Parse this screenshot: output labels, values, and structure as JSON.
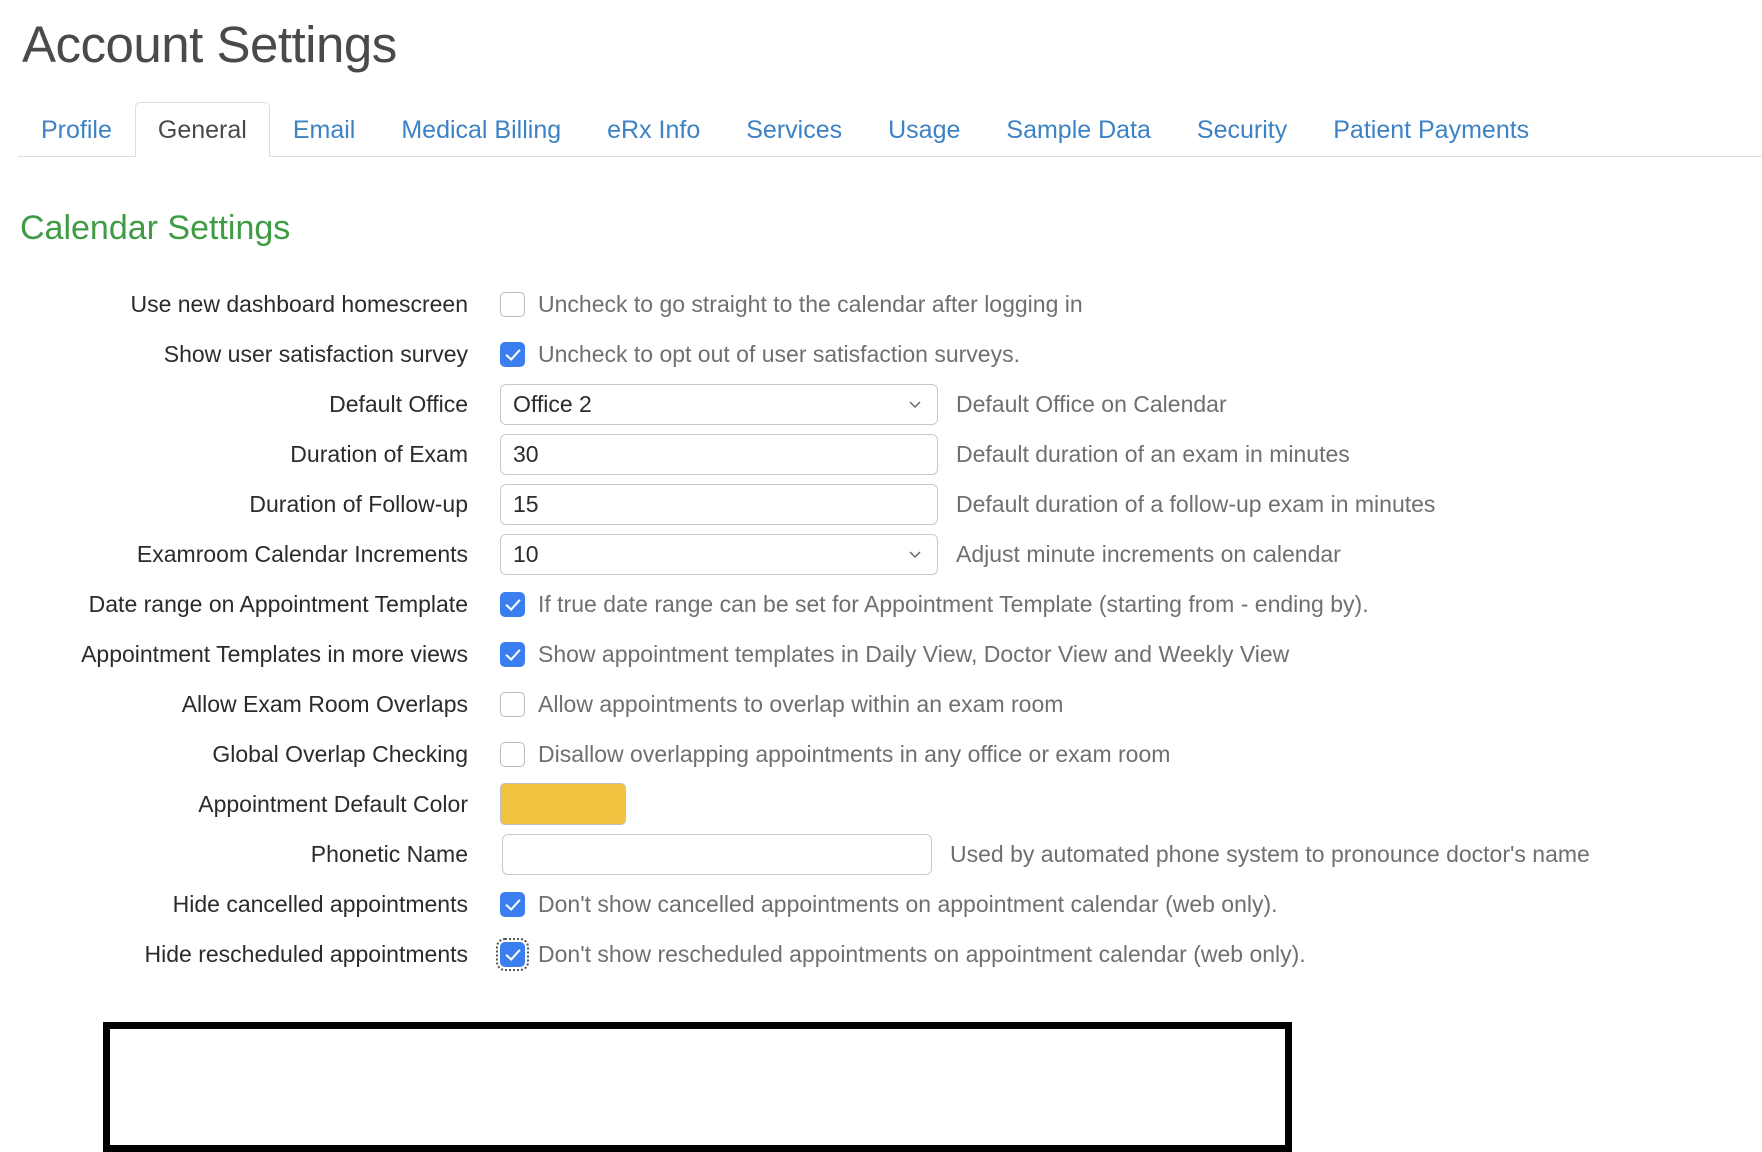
{
  "header": {
    "title": "Account Settings"
  },
  "tabs": [
    {
      "label": "Profile",
      "active": false
    },
    {
      "label": "General",
      "active": true
    },
    {
      "label": "Email",
      "active": false
    },
    {
      "label": "Medical Billing",
      "active": false
    },
    {
      "label": "eRx Info",
      "active": false
    },
    {
      "label": "Services",
      "active": false
    },
    {
      "label": "Usage",
      "active": false
    },
    {
      "label": "Sample Data",
      "active": false
    },
    {
      "label": "Security",
      "active": false
    },
    {
      "label": "Patient Payments",
      "active": false
    }
  ],
  "section": {
    "title": "Calendar Settings"
  },
  "colors": {
    "link_blue": "#3d82c4",
    "section_green": "#3f9c45",
    "checkbox_blue": "#3b7ef0",
    "appointment_default_color": "#F2C341",
    "highlight_border": "#000000"
  },
  "rows": [
    {
      "label": "Use new dashboard homescreen",
      "type": "checkbox",
      "checked": false,
      "helper": "Uncheck to go straight to the calendar after logging in"
    },
    {
      "label": "Show user satisfaction survey",
      "type": "checkbox",
      "checked": true,
      "helper": "Uncheck to opt out of user satisfaction surveys."
    },
    {
      "label": "Default Office",
      "type": "select",
      "value": "Office 2",
      "helper": "Default Office on Calendar"
    },
    {
      "label": "Duration of Exam",
      "type": "text",
      "value": "30",
      "helper": "Default duration of an exam in minutes"
    },
    {
      "label": "Duration of Follow-up",
      "type": "text",
      "value": "15",
      "helper": "Default duration of a follow-up exam in minutes"
    },
    {
      "label": "Examroom Calendar Increments",
      "type": "select",
      "value": "10",
      "helper": "Adjust minute increments on calendar"
    },
    {
      "label": "Date range on Appointment Template",
      "type": "checkbox",
      "checked": true,
      "helper": "If true date range can be set for Appointment Template (starting from - ending by)."
    },
    {
      "label": "Appointment Templates in more views",
      "type": "checkbox",
      "checked": true,
      "helper": "Show appointment templates in Daily View, Doctor View and Weekly View"
    },
    {
      "label": "Allow Exam Room Overlaps",
      "type": "checkbox",
      "checked": false,
      "helper": "Allow appointments to overlap within an exam room"
    },
    {
      "label": "Global Overlap Checking",
      "type": "checkbox",
      "checked": false,
      "helper": "Disallow overlapping appointments in any office or exam room"
    },
    {
      "label": "Appointment Default Color",
      "type": "color",
      "value": "#F2C341",
      "helper": ""
    },
    {
      "label": "Phonetic Name",
      "type": "text",
      "value": "",
      "placeholder": "",
      "helper": "Used by automated phone system to pronounce doctor's name"
    },
    {
      "label": "Hide cancelled appointments",
      "type": "checkbox",
      "checked": true,
      "helper": "Don't show cancelled appointments on appointment calendar (web only)."
    },
    {
      "label": "Hide rescheduled appointments",
      "type": "checkbox",
      "checked": true,
      "focused": true,
      "helper": "Don't show rescheduled appointments on appointment calendar (web only)."
    }
  ]
}
